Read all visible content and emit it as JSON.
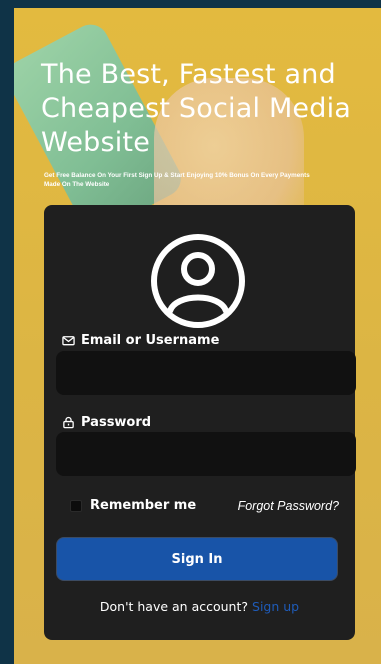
{
  "hero": {
    "title": "The Best, Fastest and Cheapest Social Media Website",
    "subtitle": "Get Free Balance On Your First Sign Up & Start Enjoying 10% Bonus On Every Payments Made On The Website"
  },
  "login": {
    "avatar_icon": "user-circle-icon",
    "email_label": "Email or Username",
    "email_icon": "envelope-icon",
    "email_value": "",
    "password_label": "Password",
    "password_icon": "lock-icon",
    "password_value": "",
    "remember_label": "Remember me",
    "remember_checked": false,
    "forgot_label": "Forgot Password?",
    "signin_label": "Sign In",
    "no_account_text": "Don't have an account?",
    "signup_label": "Sign up"
  },
  "colors": {
    "hero_background": "#e3ba3f",
    "card_background": "#1f1f1f",
    "input_background": "#111111",
    "button_background": "#1854a8",
    "link_color": "#1f5bb8",
    "page_background": "#0f3347"
  }
}
